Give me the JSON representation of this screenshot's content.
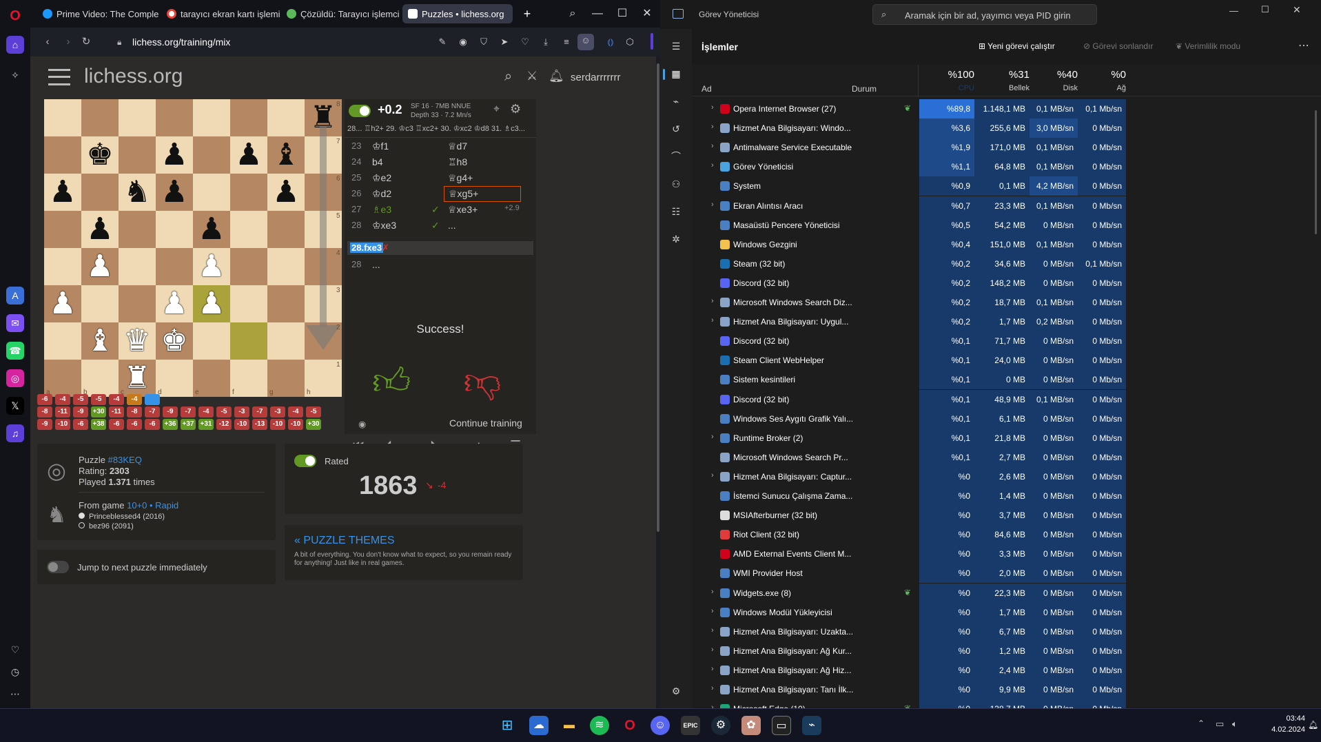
{
  "browser": {
    "tabs": [
      {
        "title": "Prime Video: The Complete",
        "color": "#1a98ff",
        "active": false
      },
      {
        "title": "tarayıcı ekran kartı işlemi",
        "color": "#ea4335",
        "active": false
      },
      {
        "title": "Çözüldü: Tarayıcı işlemci n",
        "color": "#5bb85b",
        "active": false
      },
      {
        "title": "Puzzles • lichess.org",
        "color": "#ffffff",
        "active": true
      }
    ],
    "url": "lichess.org/training/mix"
  },
  "lichess": {
    "logo": "lichess.org",
    "username": "serdarrrrrrr",
    "engine": {
      "eval": "+0.2",
      "info1": "SF 16 · 7MB NNUE",
      "info2": "Depth 33 · 7.2 Mn/s",
      "pv": "28... ♖h2+ 29. ♔c3 ♖xc2+ 30. ♔xc2 ♔d8 31. ♗c3..."
    },
    "moves": [
      {
        "num": "23",
        "white": "♔f1",
        "black": "♕d7",
        "check": ""
      },
      {
        "num": "24",
        "white": "b4",
        "black": "♖h8",
        "check": ""
      },
      {
        "num": "25",
        "white": "♔e2",
        "black": "♕g4+",
        "check": ""
      },
      {
        "num": "26",
        "white": "♔d2",
        "black": "♕xg5+",
        "check": ""
      },
      {
        "num": "27",
        "white": "♗e3",
        "black": "♕xe3+",
        "check": "✓",
        "eval": "+2.9"
      },
      {
        "num": "28",
        "white": "♔xe3",
        "black": "...",
        "check": "✓"
      }
    ],
    "wrong_move": "28.fxe3",
    "last_num": "28",
    "last_dots": "...",
    "success_text": "Success!",
    "continue_label": "Continue training",
    "puzzle": {
      "label_puzzle": "Puzzle",
      "id": "#83KEQ",
      "rating_label": "Rating:",
      "rating": "2303",
      "played_label": "Played",
      "played": "1.371",
      "played_suffix": "times",
      "from_game_label": "From game",
      "game_link": "10+0 • Rapid",
      "player1": "Princeblessed4 (2016)",
      "player2": "bez96 (2091)"
    },
    "rated_label": "Rated",
    "user_rating": "1863",
    "rating_change": "-4",
    "themes_title": "« PUZZLE THEMES",
    "themes_desc": "A bit of everything. You don't know what to expect, so you remain ready for anything! Just like in real games.",
    "jump_label": "Jump to next puzzle immediately",
    "history_row1": [
      "-6",
      "-4",
      "-5",
      "-5",
      "-4",
      "-4",
      ""
    ],
    "history_row2": [
      "-8",
      "-11",
      "-9",
      "+30",
      "-11",
      "-8",
      "-7",
      "-9",
      "-7",
      "-4",
      "-5",
      "-3",
      "-7",
      "-3",
      "-4",
      "-5"
    ],
    "history_row3": [
      "-9",
      "-10",
      "-6",
      "+38",
      "-6",
      "-6",
      "-6",
      "+36",
      "+37",
      "+31",
      "-12",
      "-10",
      "-13",
      "-10",
      "-10",
      "+30"
    ],
    "coords_files": [
      "a",
      "b",
      "c",
      "d",
      "e",
      "f",
      "g",
      "h"
    ],
    "coords_ranks": [
      "8",
      "7",
      "6",
      "5",
      "4",
      "3",
      "2",
      "1"
    ]
  },
  "taskmanager": {
    "title": "Görev Yöneticisi",
    "search_placeholder": "Aramak için bir ad, yayımcı veya PID girin",
    "section": "İşlemler",
    "new_task": "Yeni görevi çalıştır",
    "end_task": "Görevi sonlandır",
    "efficiency": "Verimlilik modu",
    "col_name": "Ad",
    "col_status": "Durum",
    "col_cpu_pct": "%100",
    "col_cpu": "CPU",
    "col_mem_pct": "%31",
    "col_mem": "Bellek",
    "col_disk_pct": "%40",
    "col_disk": "Disk",
    "col_net_pct": "%0",
    "col_net": "Ağ",
    "processes": [
      {
        "name": "Opera Internet Browser (27)",
        "cpu": "%89,8",
        "mem": "1.148,1 MB",
        "disk": "0,1 MB/sn",
        "net": "0,1 Mb/sn",
        "exp": true,
        "icon": "#d0021b",
        "eff": true
      },
      {
        "name": "Hizmet Ana Bilgisayarı: Windo...",
        "cpu": "%3,6",
        "mem": "255,6 MB",
        "disk": "3,0 MB/sn",
        "net": "0 Mb/sn",
        "exp": true,
        "icon": "#8aa4c8"
      },
      {
        "name": "Antimalware Service Executable",
        "cpu": "%1,9",
        "mem": "171,0 MB",
        "disk": "0,1 MB/sn",
        "net": "0 Mb/sn",
        "exp": true,
        "icon": "#8aa4c8"
      },
      {
        "name": "Görev Yöneticisi",
        "cpu": "%1,1",
        "mem": "64,8 MB",
        "disk": "0,1 MB/sn",
        "net": "0 Mb/sn",
        "exp": true,
        "icon": "#4aa3df"
      },
      {
        "name": "System",
        "cpu": "%0,9",
        "mem": "0,1 MB",
        "disk": "4,2 MB/sn",
        "net": "0 Mb/sn",
        "exp": false,
        "icon": "#4a7fc1"
      },
      {
        "name": "Ekran Alıntısı Aracı",
        "cpu": "%0,7",
        "mem": "23,3 MB",
        "disk": "0,1 MB/sn",
        "net": "0 Mb/sn",
        "exp": true,
        "icon": "#4a7fc1"
      },
      {
        "name": "Masaüstü Pencere Yöneticisi",
        "cpu": "%0,5",
        "mem": "54,2 MB",
        "disk": "0 MB/sn",
        "net": "0 Mb/sn",
        "exp": false,
        "icon": "#4a7fc1"
      },
      {
        "name": "Windows Gezgini",
        "cpu": "%0,4",
        "mem": "151,0 MB",
        "disk": "0,1 MB/sn",
        "net": "0 Mb/sn",
        "exp": false,
        "icon": "#f2c14e"
      },
      {
        "name": "Steam (32 bit)",
        "cpu": "%0,2",
        "mem": "34,6 MB",
        "disk": "0 MB/sn",
        "net": "0,1 Mb/sn",
        "exp": false,
        "icon": "#1b6fb0"
      },
      {
        "name": "Discord (32 bit)",
        "cpu": "%0,2",
        "mem": "148,2 MB",
        "disk": "0 MB/sn",
        "net": "0 Mb/sn",
        "exp": false,
        "icon": "#5865f2"
      },
      {
        "name": "Microsoft Windows Search Diz...",
        "cpu": "%0,2",
        "mem": "18,7 MB",
        "disk": "0,1 MB/sn",
        "net": "0 Mb/sn",
        "exp": true,
        "icon": "#8aa4c8"
      },
      {
        "name": "Hizmet Ana Bilgisayarı: Uygul...",
        "cpu": "%0,2",
        "mem": "1,7 MB",
        "disk": "0,2 MB/sn",
        "net": "0 Mb/sn",
        "exp": true,
        "icon": "#8aa4c8"
      },
      {
        "name": "Discord (32 bit)",
        "cpu": "%0,1",
        "mem": "71,7 MB",
        "disk": "0 MB/sn",
        "net": "0 Mb/sn",
        "exp": false,
        "icon": "#5865f2"
      },
      {
        "name": "Steam Client WebHelper",
        "cpu": "%0,1",
        "mem": "24,0 MB",
        "disk": "0 MB/sn",
        "net": "0 Mb/sn",
        "exp": false,
        "icon": "#1b6fb0"
      },
      {
        "name": "Sistem kesintileri",
        "cpu": "%0,1",
        "mem": "0 MB",
        "disk": "0 MB/sn",
        "net": "0 Mb/sn",
        "exp": false,
        "icon": "#4a7fc1"
      },
      {
        "name": "Discord (32 bit)",
        "cpu": "%0,1",
        "mem": "48,9 MB",
        "disk": "0,1 MB/sn",
        "net": "0 Mb/sn",
        "exp": false,
        "icon": "#5865f2"
      },
      {
        "name": "Windows Ses Aygıtı Grafik Yalı...",
        "cpu": "%0,1",
        "mem": "6,1 MB",
        "disk": "0 MB/sn",
        "net": "0 Mb/sn",
        "exp": false,
        "icon": "#4a7fc1"
      },
      {
        "name": "Runtime Broker (2)",
        "cpu": "%0,1",
        "mem": "21,8 MB",
        "disk": "0 MB/sn",
        "net": "0 Mb/sn",
        "exp": true,
        "icon": "#4a7fc1"
      },
      {
        "name": "Microsoft Windows Search Pr...",
        "cpu": "%0,1",
        "mem": "2,7 MB",
        "disk": "0 MB/sn",
        "net": "0 Mb/sn",
        "exp": false,
        "icon": "#8aa4c8"
      },
      {
        "name": "Hizmet Ana Bilgisayarı: Captur...",
        "cpu": "%0",
        "mem": "2,6 MB",
        "disk": "0 MB/sn",
        "net": "0 Mb/sn",
        "exp": true,
        "icon": "#8aa4c8"
      },
      {
        "name": "İstemci Sunucu Çalışma Zama...",
        "cpu": "%0",
        "mem": "1,4 MB",
        "disk": "0 MB/sn",
        "net": "0 Mb/sn",
        "exp": false,
        "icon": "#4a7fc1"
      },
      {
        "name": "MSIAfterburner (32 bit)",
        "cpu": "%0",
        "mem": "3,7 MB",
        "disk": "0 MB/sn",
        "net": "0 Mb/sn",
        "exp": false,
        "icon": "#dddddd"
      },
      {
        "name": "Riot Client (32 bit)",
        "cpu": "%0",
        "mem": "84,6 MB",
        "disk": "0 MB/sn",
        "net": "0 Mb/sn",
        "exp": false,
        "icon": "#e23b3b"
      },
      {
        "name": "AMD External Events Client M...",
        "cpu": "%0",
        "mem": "3,3 MB",
        "disk": "0 MB/sn",
        "net": "0 Mb/sn",
        "exp": false,
        "icon": "#d0021b"
      },
      {
        "name": "WMI Provider Host",
        "cpu": "%0",
        "mem": "2,0 MB",
        "disk": "0 MB/sn",
        "net": "0 Mb/sn",
        "exp": false,
        "icon": "#4a7fc1"
      },
      {
        "name": "Widgets.exe (8)",
        "cpu": "%0",
        "mem": "22,3 MB",
        "disk": "0 MB/sn",
        "net": "0 Mb/sn",
        "exp": true,
        "icon": "#4a7fc1",
        "eff": true
      },
      {
        "name": "Windows Modül Yükleyicisi",
        "cpu": "%0",
        "mem": "1,7 MB",
        "disk": "0 MB/sn",
        "net": "0 Mb/sn",
        "exp": true,
        "icon": "#4a7fc1"
      },
      {
        "name": "Hizmet Ana Bilgisayarı: Uzakta...",
        "cpu": "%0",
        "mem": "6,7 MB",
        "disk": "0 MB/sn",
        "net": "0 Mb/sn",
        "exp": true,
        "icon": "#8aa4c8"
      },
      {
        "name": "Hizmet Ana Bilgisayarı: Ağ Kur...",
        "cpu": "%0",
        "mem": "1,2 MB",
        "disk": "0 MB/sn",
        "net": "0 Mb/sn",
        "exp": true,
        "icon": "#8aa4c8"
      },
      {
        "name": "Hizmet Ana Bilgisayarı: Ağ Hiz...",
        "cpu": "%0",
        "mem": "2,4 MB",
        "disk": "0 MB/sn",
        "net": "0 Mb/sn",
        "exp": true,
        "icon": "#8aa4c8"
      },
      {
        "name": "Hizmet Ana Bilgisayarı: Tanı İlk...",
        "cpu": "%0",
        "mem": "9,9 MB",
        "disk": "0 MB/sn",
        "net": "0 Mb/sn",
        "exp": true,
        "icon": "#8aa4c8"
      },
      {
        "name": "Microsoft Edge (10)",
        "cpu": "%0",
        "mem": "138,7 MB",
        "disk": "0 MB/sn",
        "net": "0 Mb/sn",
        "exp": true,
        "icon": "#1fa37a",
        "eff": true
      }
    ]
  },
  "taskbar": {
    "time": "03:44",
    "date": "4.02.2024"
  }
}
